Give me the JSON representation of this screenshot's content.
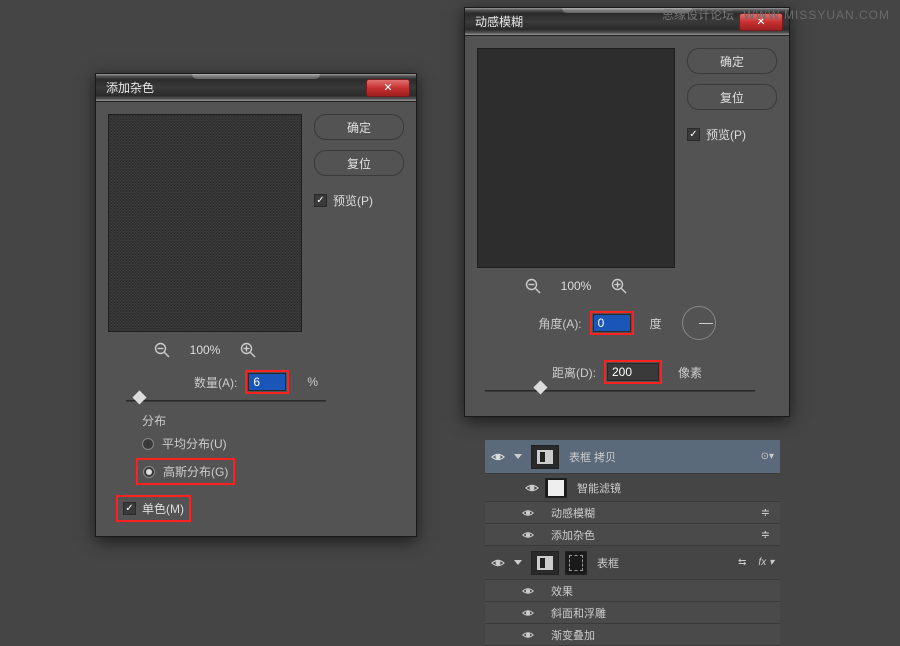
{
  "watermark": {
    "cn": "思缘设计论坛",
    "en": "WWW.MISSYUAN.COM"
  },
  "noise_dialog": {
    "title": "添加杂色",
    "ok": "确定",
    "reset": "复位",
    "preview": "预览(P)",
    "zoom": "100%",
    "amount_label": "数量(A):",
    "amount_value": "6",
    "amount_unit": "%",
    "dist_title": "分布",
    "uniform": "平均分布(U)",
    "gaussian": "高斯分布(G)",
    "mono": "单色(M)"
  },
  "motion_dialog": {
    "title": "动感模糊",
    "ok": "确定",
    "reset": "复位",
    "preview": "预览(P)",
    "zoom": "100%",
    "angle_label": "角度(A):",
    "angle_value": "0",
    "angle_unit": "度",
    "dist_label": "距离(D):",
    "dist_value": "200",
    "dist_unit": "像素"
  },
  "layers": {
    "items": [
      {
        "name": "表框 拷贝"
      },
      {
        "name": "智能滤镜"
      },
      {
        "name": "动感模糊"
      },
      {
        "name": "添加杂色"
      },
      {
        "name": "表框"
      },
      {
        "name": "效果"
      },
      {
        "name": "斜面和浮雕"
      },
      {
        "name": "渐变叠加"
      }
    ]
  }
}
